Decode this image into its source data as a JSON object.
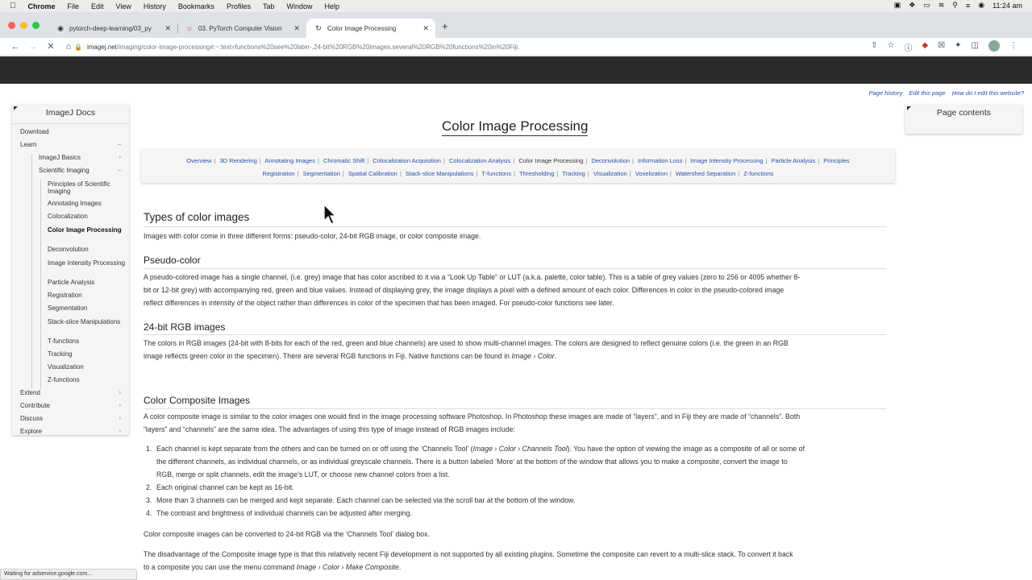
{
  "menubar": {
    "items": [
      "Chrome",
      "File",
      "Edit",
      "View",
      "History",
      "Bookmarks",
      "Profiles",
      "Tab",
      "Window",
      "Help"
    ],
    "time": "11:24 am"
  },
  "tabs": [
    {
      "title": "pytorch-deep-learning/03_py",
      "icon": "github-icon"
    },
    {
      "title": "03. PyTorch Computer Vision",
      "icon": "pytorch-icon"
    },
    {
      "title": "Color Image Processing",
      "icon": "loading-spinner-icon"
    }
  ],
  "url": {
    "domain": "imagej.net",
    "path": "/imaging/color-image-processing#:~:text=functions%20see%20later-,24-bit%20RGB%20images,several%20RGB%20functions%20in%20Fiji."
  },
  "top_links": [
    "Page history",
    "Edit this page",
    "How do I edit this website?"
  ],
  "sidebar": {
    "title": "ImageJ Docs",
    "download": "Download",
    "learn": "Learn",
    "imagej_basics": "ImageJ Basics",
    "scientific_imaging": "Scientific Imaging",
    "sub_items": [
      "Principles of Scientific Imaging",
      "Annotating Images",
      "Colocalization",
      "Color Image Processing",
      "Deconvolution",
      "Image Intensity Processing",
      "Particle Analysis",
      "Registration",
      "Segmentation",
      "Stack-slice Manipulations",
      "T-functions",
      "Tracking",
      "Visualization",
      "Z-functions"
    ],
    "extend": "Extend",
    "contribute": "Contribute",
    "discuss": "Discuss",
    "explore": "Explore"
  },
  "page_contents_title": "Page contents",
  "page_title": "Color Image Processing",
  "topic_nav": {
    "row1": [
      "Overview",
      "3D Rendering",
      "Annotating Images",
      "Chromatic Shift",
      "Colocalization Acquisition",
      "Colocalization Analysis",
      "Color Image Processing",
      "Deconvolution",
      "Information Loss",
      "Image Intensity Processing",
      "Particle Analysis",
      "Principles"
    ],
    "row2": [
      "Registration",
      "Segmentation",
      "Spatial Calibration",
      "Stack-slice Manipulations",
      "T-functions",
      "Thresholding",
      "Tracking",
      "Visualization",
      "Voxelization",
      "Watershed Separation",
      "Z-functions"
    ]
  },
  "sections": {
    "types_heading": "Types of color images",
    "types_text": "Images with color come in three different forms: pseudo-color, 24-bit RGB image, or color composite image.",
    "pseudo_heading": "Pseudo-color",
    "pseudo_line1": "A pseudo-colored image has a single channel, (i.e. grey) image that has color ascribed to it via a “Look Up Table” or LUT (a.k.a. palette, color table). This is a table of grey values (zero to 256 or 4095 whether 8-",
    "pseudo_line2": "bit or 12-bit grey) with accompanying red, green and blue values. Instead of displaying grey, the image displays a pixel with a defined amount of each color. Differences in color in the pseudo-colored image",
    "pseudo_line3": "reflect differences in intensity of the object rather than differences in color of the specimen that has been imaged. For pseudo-color functions see later.",
    "rgb_heading": "24-bit RGB images",
    "rgb_line1": "The colors in RGB images (24-bit with 8-bits for each of the red, green and blue channels) are used to show multi-channel images. The colors are designed to reflect genuine colors (i.e. the green in an RGB",
    "rgb_line2": "image reflects green color in the specimen). There are several RGB functions in Fiji. Native functions can be found in",
    "rgb_line2_path": "Image › Color",
    "composite_heading": "Color Composite Images",
    "composite_line1": "A color composite image is similar to the color images one would find in the image processing software Photoshop. In Photoshop these images are made of “layers”, and in Fiji they are made of “channels”. Both",
    "composite_line2": "“layers” and “channels” are the same idea. The advantages of using this type of image instead of RGB images include:",
    "list": {
      "item1_a": "Each channel is kept separate from the others and can be turned on or off using the ‘Channels Tool’ (",
      "item1_path": "Image › Color › Channels Tool",
      "item1_b": "). You have the option of viewing the image as a composite of all or some of",
      "item1_line2": "the different channels, as individual channels, or as individual greyscale channels. There is a button labeled ‘More’ at the bottom of the window that allows you to make a composite, convert the image to",
      "item1_line3": "RGB, merge or split channels, edit the image’s LUT, or choose new channel colors from a list.",
      "item2": "Each original channel can be kept as 16-bit.",
      "item3": "More than 3 channels can be merged and kept separate. Each channel can be selected via the scroll bar at the bottom of the window.",
      "item4": "The contrast and brightness of individual channels can be adjusted after merging."
    },
    "convert_text": "Color composite images can be converted to 24-bit RGB via the ‘Channels Tool’ dialog box.",
    "disadv_line1": "The disadvantage of the Composite image type is that this relatively recent Fiji development is not supported by all existing plugins. Sometime the composite can revert to a multi-slice stack. To convert it back",
    "disadv_line2": "to a composite you can use the menu command",
    "disadv_path": "Image › Color › Make Composite"
  },
  "status_bar": "Waiting for adservice.google.com...",
  "colors": {
    "link": "#2a4fa7",
    "dark_band": "#2b2b2b",
    "panel": "#f5f5f5"
  }
}
